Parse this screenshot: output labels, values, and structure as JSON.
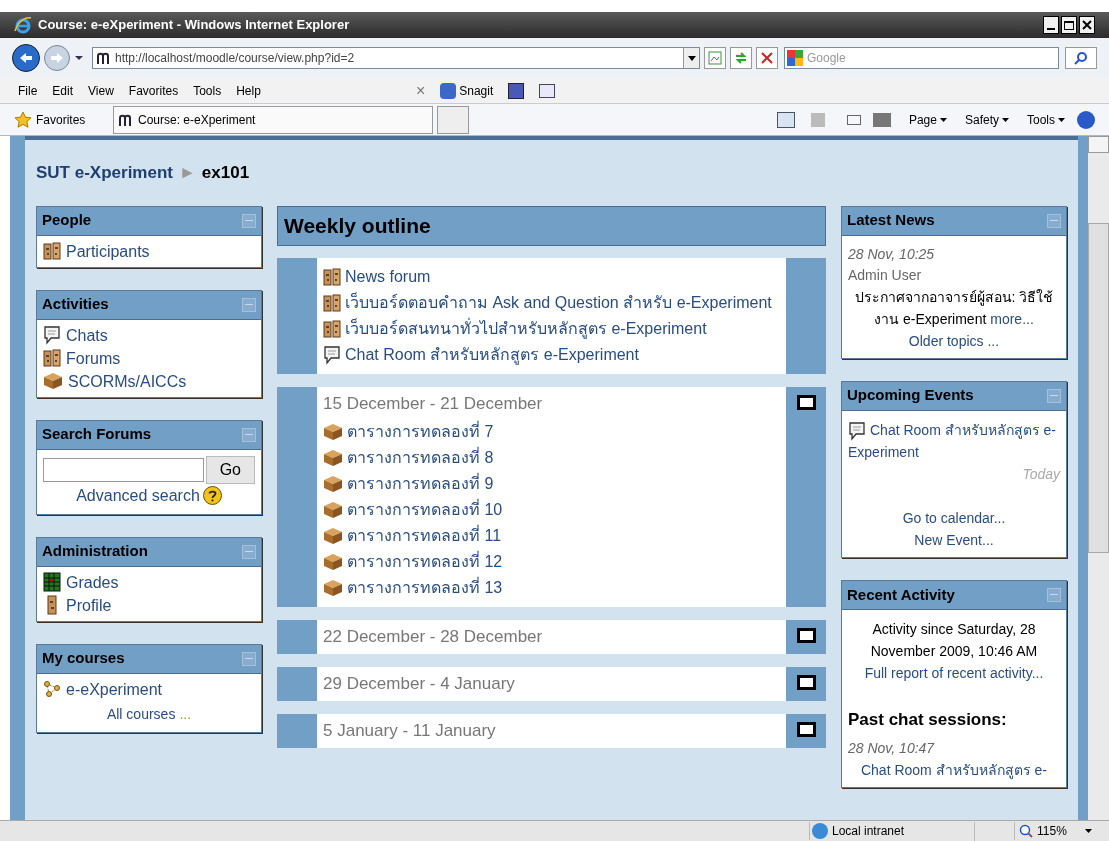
{
  "window": {
    "title": "Course: e-eXperiment - Windows Internet Explorer"
  },
  "address_bar": {
    "url": "http://localhost/moodle/course/view.php?id=2",
    "search_placeholder": "Google"
  },
  "menu": [
    "File",
    "Edit",
    "View",
    "Favorites",
    "Tools",
    "Help"
  ],
  "toolbar": {
    "close": "×",
    "snagit": "Snagit"
  },
  "favorites_bar": {
    "label": "Favorites",
    "tab": "Course: e-eXperiment"
  },
  "command_bar": [
    "Page",
    "Safety",
    "Tools"
  ],
  "breadcrumb": {
    "site": "SUT e-Xperiment",
    "separator": "►",
    "course": "ex101"
  },
  "left_blocks": [
    {
      "title": "People",
      "items": [
        {
          "kind": "forum",
          "label": "Participants"
        }
      ]
    },
    {
      "title": "Activities",
      "items": [
        {
          "kind": "chat",
          "label": "Chats"
        },
        {
          "kind": "forum",
          "label": "Forums"
        },
        {
          "kind": "scorm",
          "label": "SCORMs/AICCs"
        }
      ]
    },
    {
      "title": "Search Forums",
      "search": {
        "button": "Go",
        "link": "Advanced search"
      }
    },
    {
      "title": "Administration",
      "items": [
        {
          "kind": "grades",
          "label": "Grades"
        },
        {
          "kind": "profile",
          "label": "Profile"
        }
      ]
    },
    {
      "title": "My courses",
      "items": [
        {
          "kind": "course",
          "label": "e-eXperiment"
        }
      ],
      "footer": "All courses",
      "footer_ellipsis": "..."
    }
  ],
  "outline": {
    "title": "Weekly outline",
    "sections": [
      {
        "items": [
          {
            "kind": "forum",
            "label": "News forum"
          },
          {
            "kind": "forum",
            "label": "เว็บบอร์ดตอบคำถาม Ask and Question สำหรับ e-Experiment"
          },
          {
            "kind": "forum",
            "label": "เว็บบอร์ดสนทนาทั่วไปสำหรับหลักสูตร e-Experiment"
          },
          {
            "kind": "chat",
            "label": "Chat Room สำหรับหลักสูตร e-Experiment"
          }
        ]
      },
      {
        "title": "15 December - 21 December",
        "items": [
          {
            "kind": "scorm",
            "label": "ตารางการทดลองที่ 7"
          },
          {
            "kind": "scorm",
            "label": "ตารางการทดลองที่ 8"
          },
          {
            "kind": "scorm",
            "label": "ตารางการทดลองที่ 9"
          },
          {
            "kind": "scorm",
            "label": "ตารางการทดลองที่ 10"
          },
          {
            "kind": "scorm",
            "label": "ตารางการทดลองที่ 11"
          },
          {
            "kind": "scorm",
            "label": "ตารางการทดลองที่ 12"
          },
          {
            "kind": "scorm",
            "label": "ตารางการทดลองที่ 13"
          }
        ]
      },
      {
        "title": "22 December - 28 December"
      },
      {
        "title": "29 December - 4 January"
      },
      {
        "title": "5 January - 11 January"
      }
    ]
  },
  "right_blocks": [
    {
      "title": "Latest News",
      "lines": [
        {
          "kind": "date",
          "text": "28 Nov, 10:25"
        },
        {
          "kind": "author",
          "text": "Admin User"
        },
        {
          "kind": "news",
          "text": "ประกาศจากอาจารย์ผู้สอน: วิธีใช้งาน e-Experiment",
          "link": "more..."
        },
        {
          "kind": "link",
          "text": "Older topics ..."
        }
      ]
    },
    {
      "title": "Upcoming Events",
      "lines": [
        {
          "kind": "event",
          "text": "Chat Room สำหรับหลักสูตร e-Experiment"
        },
        {
          "kind": "when",
          "text": "Today"
        },
        {
          "kind": "spacer"
        },
        {
          "kind": "link",
          "text": "Go to calendar..."
        },
        {
          "kind": "link",
          "text": "New Event..."
        }
      ]
    },
    {
      "title": "Recent Activity",
      "lines": [
        {
          "kind": "text",
          "text": "Activity since Saturday, 28 November 2009, 10:46 AM"
        },
        {
          "kind": "link",
          "text": "Full report of recent activity..."
        },
        {
          "kind": "spacer"
        },
        {
          "kind": "heading",
          "text": "Past chat sessions:"
        },
        {
          "kind": "date",
          "text": "28 Nov, 10:47"
        },
        {
          "kind": "link",
          "text": "Chat Room สำหรับหลักสูตร e-"
        }
      ]
    }
  ],
  "status_bar": {
    "zone": "Local intranet",
    "zoom": "115%"
  }
}
